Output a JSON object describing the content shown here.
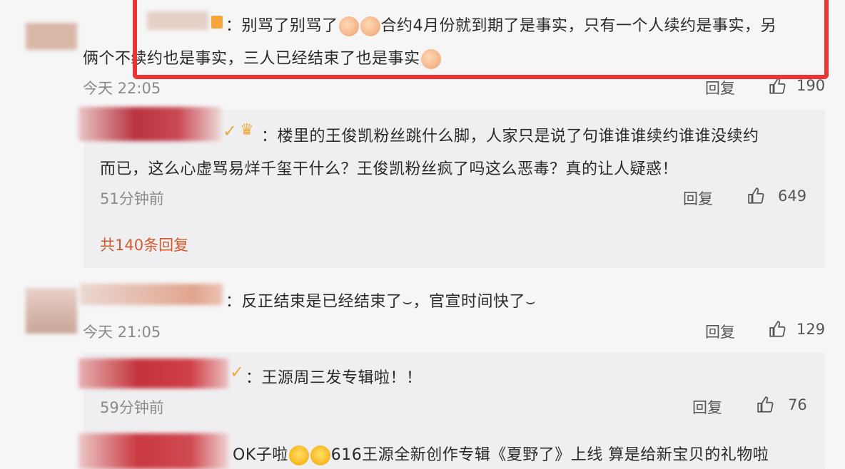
{
  "comments": [
    {
      "text_line1": "：别骂了别骂了",
      "text_line1_tail": "合约4月份就到期了是事实，只有一个人续约是事实，另",
      "text_line2": "俩个不续约也是事实，三人已经结束了也是事实",
      "time": "今天 22:05",
      "reply_label": "回复",
      "likes": "190"
    },
    {
      "text": "：反正结束是已经结束了",
      "text_tail": "，官宣时间快了",
      "time": "今天 21:05",
      "reply_label": "回复",
      "likes": "129"
    }
  ],
  "replies": [
    {
      "text_line1": "：楼里的王俊凯粉丝跳什么脚，人家只是说了句谁谁谁续约谁谁没续约",
      "text_line2": "而已，这么心虚骂易烊千玺干什么？王俊凯粉丝疯了吗这么恶毒？真的让人疑惑！",
      "time": "51分钟前",
      "reply_label": "回复",
      "likes": "649",
      "more_replies": "共140条回复"
    },
    {
      "text": "：王源周三发专辑啦！！",
      "time": "59分钟前",
      "reply_label": "回复",
      "likes": "76"
    },
    {
      "text_head": "OK子啦",
      "text_tail": "616王源全新创作专辑《夏野了》上线 算是给新宝贝的礼物啦"
    }
  ],
  "colors": {
    "highlight": "#ee3333",
    "more_link": "#d9582a",
    "verified": "#f2a93b"
  }
}
